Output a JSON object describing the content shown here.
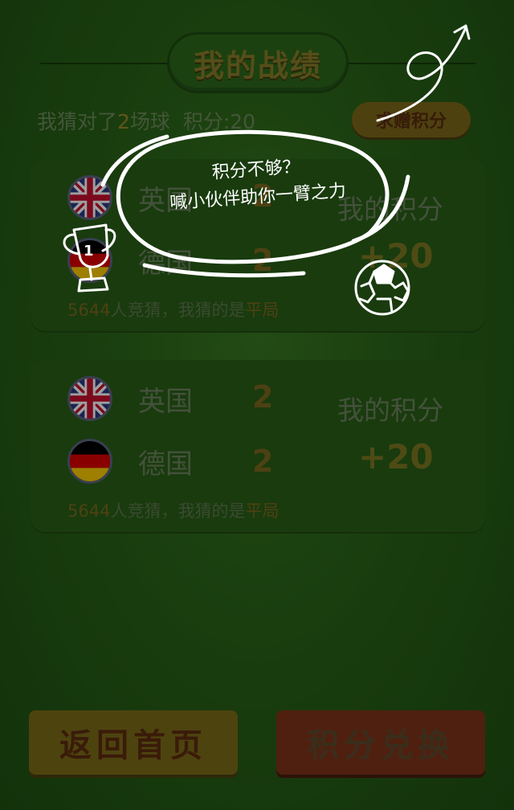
{
  "header": {
    "title": "我的战绩"
  },
  "summary": {
    "prefix": "我猜对了",
    "count": "2",
    "suffix": "场球",
    "points_label": "积分:20"
  },
  "ask_button": {
    "label": "求赠积分"
  },
  "popup": {
    "line1": "积分不够？",
    "line2": "喊小伙伴助你一臂之力"
  },
  "matches": [
    {
      "team1": {
        "name": "英国",
        "score": "2",
        "flag_icon": "uk-flag-icon"
      },
      "team2": {
        "name": "德国",
        "score": "2",
        "flag_icon": "germany-flag-icon"
      },
      "my_label": "我的积分",
      "my_points": "+20",
      "participants": "5644",
      "guess_text": "人竞猜，我猜的是",
      "guess_result": "平局"
    },
    {
      "team1": {
        "name": "英国",
        "score": "2",
        "flag_icon": "uk-flag-icon"
      },
      "team2": {
        "name": "德国",
        "score": "2",
        "flag_icon": "germany-flag-icon"
      },
      "my_label": "我的积分",
      "my_points": "+20",
      "participants": "5644",
      "guess_text": "人竞猜，我猜的是",
      "guess_result": "平局"
    }
  ],
  "buttons": {
    "home": "返回首页",
    "exchange": "积分兑换"
  },
  "colors": {
    "background": "#2a6418",
    "highlight": "#9f8a2a",
    "overlay": "#000000"
  }
}
